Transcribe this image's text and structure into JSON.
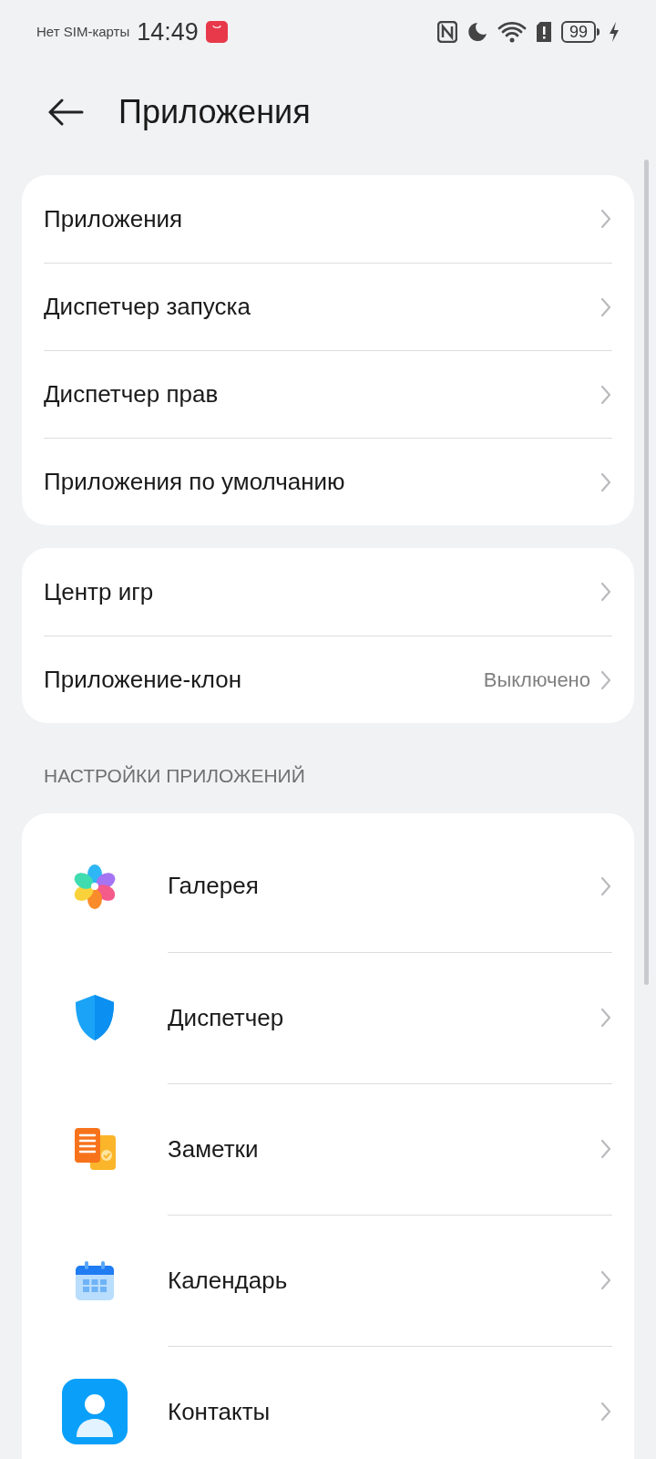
{
  "status_bar": {
    "carrier": "Нет SIM-карты",
    "time": "14:49",
    "battery": "99"
  },
  "header": {
    "title": "Приложения"
  },
  "groups": [
    {
      "items": [
        {
          "label": "Приложения"
        },
        {
          "label": "Диспетчер запуска"
        },
        {
          "label": "Диспетчер прав"
        },
        {
          "label": "Приложения по умолчанию"
        }
      ]
    },
    {
      "items": [
        {
          "label": "Центр игр"
        },
        {
          "label": "Приложение-клон",
          "value": "Выключено"
        }
      ]
    }
  ],
  "app_settings": {
    "title": "НАСТРОЙКИ ПРИЛОЖЕНИЙ",
    "items": [
      {
        "label": "Галерея"
      },
      {
        "label": "Диспетчер"
      },
      {
        "label": "Заметки"
      },
      {
        "label": "Календарь"
      },
      {
        "label": "Контакты"
      }
    ]
  }
}
